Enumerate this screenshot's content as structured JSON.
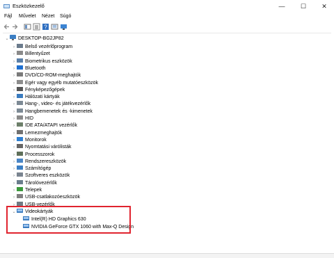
{
  "window": {
    "title": "Eszközkezelő",
    "minimize": "—",
    "maximize": "☐",
    "close": "✕"
  },
  "menu": [
    "Fájl",
    "Művelet",
    "Nézet",
    "Súgó"
  ],
  "tree": {
    "root": "DESKTOP-BG2JP82",
    "categories": [
      {
        "label": "Belső vezérlőprogram",
        "icon": "firmware-icon",
        "color": "#6b7b8c"
      },
      {
        "label": "Billentyűzet",
        "icon": "keyboard-icon",
        "color": "#8a8a8a"
      },
      {
        "label": "Biometrikus eszközök",
        "icon": "biometric-icon",
        "color": "#5a7fa8"
      },
      {
        "label": "Bluetooth",
        "icon": "bluetooth-icon",
        "color": "#1e6fd0"
      },
      {
        "label": "DVD/CD-ROM-meghajtók",
        "icon": "disc-drive-icon",
        "color": "#7a7a7a"
      },
      {
        "label": "Egér vagy egyéb mutatóeszközök",
        "icon": "mouse-icon",
        "color": "#8c8c8c"
      },
      {
        "label": "Fényképezőgépek",
        "icon": "camera-icon",
        "color": "#555555"
      },
      {
        "label": "Hálózati kártyák",
        "icon": "network-icon",
        "color": "#3a7bbf"
      },
      {
        "label": "Hang-, video- és játékvezérlők",
        "icon": "sound-icon",
        "color": "#7d8a95"
      },
      {
        "label": "Hangbemenetek és -kimenetek",
        "icon": "speaker-icon",
        "color": "#7d8a95"
      },
      {
        "label": "HID",
        "icon": "hid-icon",
        "color": "#8a8a8a"
      },
      {
        "label": "IDE ATA/ATAPI vezérlők",
        "icon": "ide-icon",
        "color": "#6d7f6a"
      },
      {
        "label": "Lemezmeghajtók",
        "icon": "disk-icon",
        "color": "#707070"
      },
      {
        "label": "Monitorok",
        "icon": "monitor-icon",
        "color": "#2e7fd1"
      },
      {
        "label": "Nyomtatási várólisták",
        "icon": "printer-icon",
        "color": "#666666"
      },
      {
        "label": "Processzorok",
        "icon": "processor-icon",
        "color": "#5f6f5a"
      },
      {
        "label": "Rendszereszközök",
        "icon": "system-icon",
        "color": "#4a86c6"
      },
      {
        "label": "Számítógép",
        "icon": "computer-icon",
        "color": "#3b7fc4"
      },
      {
        "label": "Szoftveres eszközök",
        "icon": "software-device-icon",
        "color": "#7a8490"
      },
      {
        "label": "Tárolóvezérlők",
        "icon": "storage-icon",
        "color": "#6a7d8c"
      },
      {
        "label": "Telepek",
        "icon": "battery-icon",
        "color": "#3c9a3c"
      },
      {
        "label": "USB-csatlakozóeszközök",
        "icon": "usb-connector-icon",
        "color": "#808080"
      },
      {
        "label": "USB-vezérlők",
        "icon": "usb-icon",
        "color": "#707a84"
      }
    ],
    "expanded": {
      "label": "Videokártyák",
      "icon": "display-adapter-icon",
      "children": [
        "Intel(R) HD Graphics 630",
        "NVIDIA GeForce GTX 1060 with Max-Q Design"
      ]
    }
  }
}
